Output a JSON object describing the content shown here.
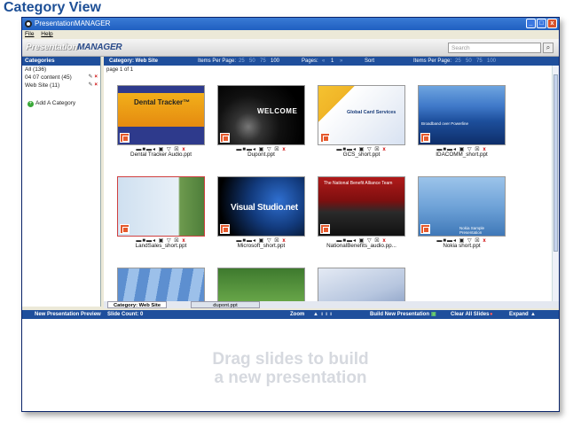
{
  "page_heading": "Category View",
  "window": {
    "title": "PresentationMANAGER",
    "buttons": [
      "_",
      "□",
      "x"
    ]
  },
  "menu": [
    "File",
    "Help"
  ],
  "brand": {
    "light": "Presentation",
    "bold": "MANAGER"
  },
  "search": {
    "placeholder": "Search",
    "icon": "search-icon"
  },
  "sidebar": {
    "header": "Categories",
    "items": [
      {
        "label": "All (136)",
        "editable": false
      },
      {
        "label": "04 07 content (45)",
        "editable": true
      },
      {
        "label": "Web Site (11)",
        "editable": true
      }
    ],
    "add_label": "Add A Category"
  },
  "toolbar": {
    "category": "Category: Web Site",
    "items_per_page_label": "Items Per Page:",
    "items_per_page_options": [
      "25",
      "50",
      "75",
      "100"
    ],
    "pages_label": "Pages:",
    "pages_prev": "«",
    "pages_current": "1",
    "pages_next": "»",
    "sort_label": "Sort",
    "items_per_page_label_2": "Items Per Page:",
    "items_per_page_options_2": [
      "25",
      "50",
      "75",
      "100"
    ]
  },
  "page_info": "page 1 of 1",
  "slides": [
    {
      "name": "Dental Tracker Audio.ppt",
      "title": "Dental Tracker™"
    },
    {
      "name": "Dupont.ppt",
      "title": "WELCOME"
    },
    {
      "name": "GCS_short.ppt",
      "title": "Global Card Services"
    },
    {
      "name": "IDACOMM_short.ppt",
      "title": "Broadband over Powerline"
    },
    {
      "name": "LandSales_short.ppt",
      "title": ""
    },
    {
      "name": "Microsoft_short.ppt",
      "title": "Visual Studio.net"
    },
    {
      "name": "NationalBenefits_audio.pp...",
      "title": "The National Benefit Alliance Team"
    },
    {
      "name": "Nokia short.ppt",
      "title": "Nokia Sample Presentation"
    },
    {
      "name": "",
      "title": ""
    },
    {
      "name": "",
      "title": ""
    },
    {
      "name": "",
      "title": ""
    }
  ],
  "slide_tools": "▬■▬◂ ▣ ▽ ☒",
  "slide_delete": "x",
  "tabs": [
    {
      "label": "Category: Web Site",
      "active": true
    },
    {
      "label": "dupont.ppt",
      "active": false
    }
  ],
  "preview_bar": {
    "title": "New Presentation Preview",
    "slide_count": "Slide Count: 0",
    "zoom": "Zoom",
    "build": "Build New Presentation",
    "clear": "Clear All Slides",
    "expand": "Expand"
  },
  "drop_hint_line1": "Drag slides to build",
  "drop_hint_line2": "a new presentation",
  "colors": {
    "bar_blue": "#1f4f9c",
    "title_blue": "#1d4f96",
    "delete_red": "#cc0000",
    "ppt_orange": "#e5592c"
  }
}
